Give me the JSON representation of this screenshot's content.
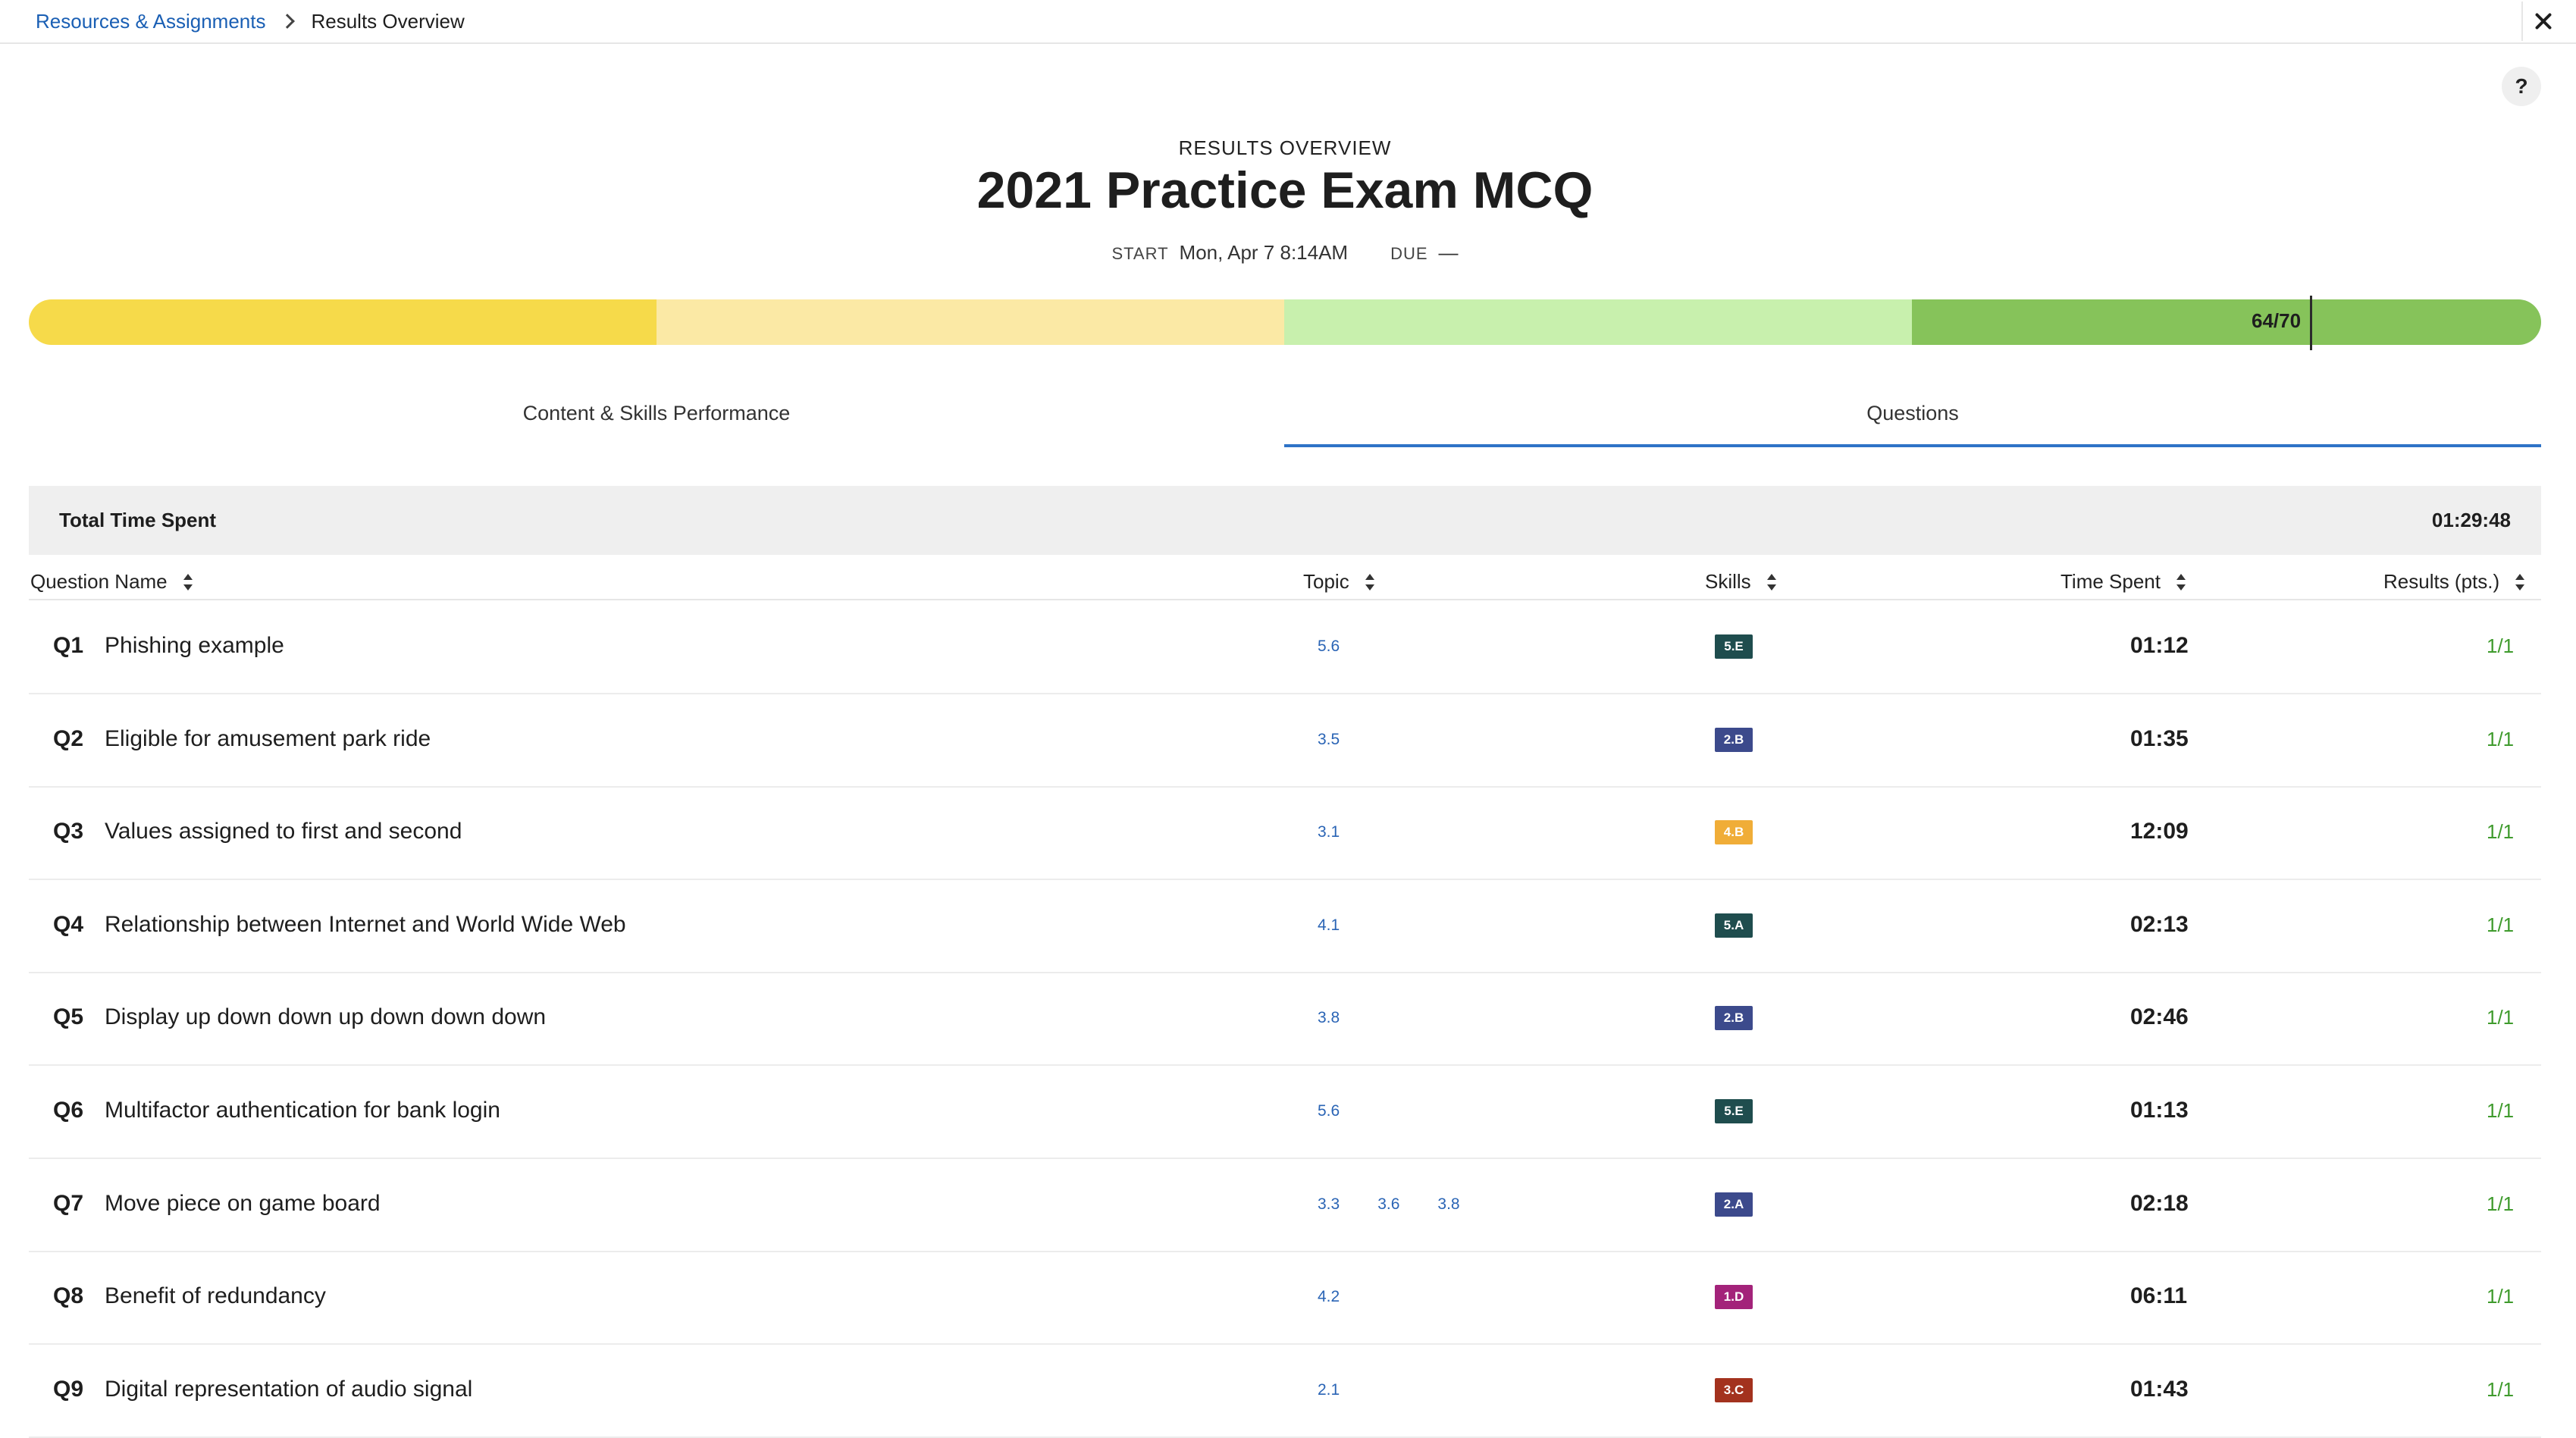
{
  "breadcrumb": {
    "parent": "Resources & Assignments",
    "current": "Results Overview"
  },
  "header": {
    "overline": "RESULTS OVERVIEW",
    "title": "2021 Practice Exam MCQ",
    "start_key": "START",
    "start_value": "Mon, Apr 7 8:14AM",
    "due_key": "DUE",
    "due_value": "—"
  },
  "help_label": "?",
  "score": {
    "label": "64/70",
    "points": 64,
    "max": 70,
    "colors": [
      "#f6da4a",
      "#fbe9a5",
      "#c8f0ad",
      "#86c35a"
    ]
  },
  "tabs": [
    {
      "label": "Content & Skills Performance",
      "active": false
    },
    {
      "label": "Questions",
      "active": true
    }
  ],
  "total": {
    "label": "Total Time Spent",
    "value": "01:29:48"
  },
  "columns": {
    "name": "Question Name",
    "topic": "Topic",
    "skills": "Skills",
    "time": "Time Spent",
    "results": "Results (pts.)"
  },
  "questions": [
    {
      "num": "Q1",
      "name": "Phishing example",
      "topics": [
        "5.6"
      ],
      "skill": "5.E",
      "skill_color": "#1f4d4e",
      "time": "01:12",
      "result": "1/1"
    },
    {
      "num": "Q2",
      "name": "Eligible for amusement park ride",
      "topics": [
        "3.5"
      ],
      "skill": "2.B",
      "skill_color": "#3c4a8c",
      "time": "01:35",
      "result": "1/1"
    },
    {
      "num": "Q3",
      "name": "Values assigned to first and second",
      "topics": [
        "3.1"
      ],
      "skill": "4.B",
      "skill_color": "#f0ad38",
      "time": "12:09",
      "result": "1/1"
    },
    {
      "num": "Q4",
      "name": "Relationship between Internet and World Wide Web",
      "topics": [
        "4.1"
      ],
      "skill": "5.A",
      "skill_color": "#1f4d4e",
      "time": "02:13",
      "result": "1/1"
    },
    {
      "num": "Q5",
      "name": "Display up down down up down down down",
      "topics": [
        "3.8"
      ],
      "skill": "2.B",
      "skill_color": "#3c4a8c",
      "time": "02:46",
      "result": "1/1"
    },
    {
      "num": "Q6",
      "name": "Multifactor authentication for bank login",
      "topics": [
        "5.6"
      ],
      "skill": "5.E",
      "skill_color": "#1f4d4e",
      "time": "01:13",
      "result": "1/1"
    },
    {
      "num": "Q7",
      "name": "Move piece on game board",
      "topics": [
        "3.3",
        "3.6",
        "3.8"
      ],
      "skill": "2.A",
      "skill_color": "#3c4a8c",
      "time": "02:18",
      "result": "1/1"
    },
    {
      "num": "Q8",
      "name": "Benefit of redundancy",
      "topics": [
        "4.2"
      ],
      "skill": "1.D",
      "skill_color": "#a3237a",
      "time": "06:11",
      "result": "1/1"
    },
    {
      "num": "Q9",
      "name": "Digital representation of audio signal",
      "topics": [
        "2.1"
      ],
      "skill": "3.C",
      "skill_color": "#a3321e",
      "time": "01:43",
      "result": "1/1"
    }
  ]
}
